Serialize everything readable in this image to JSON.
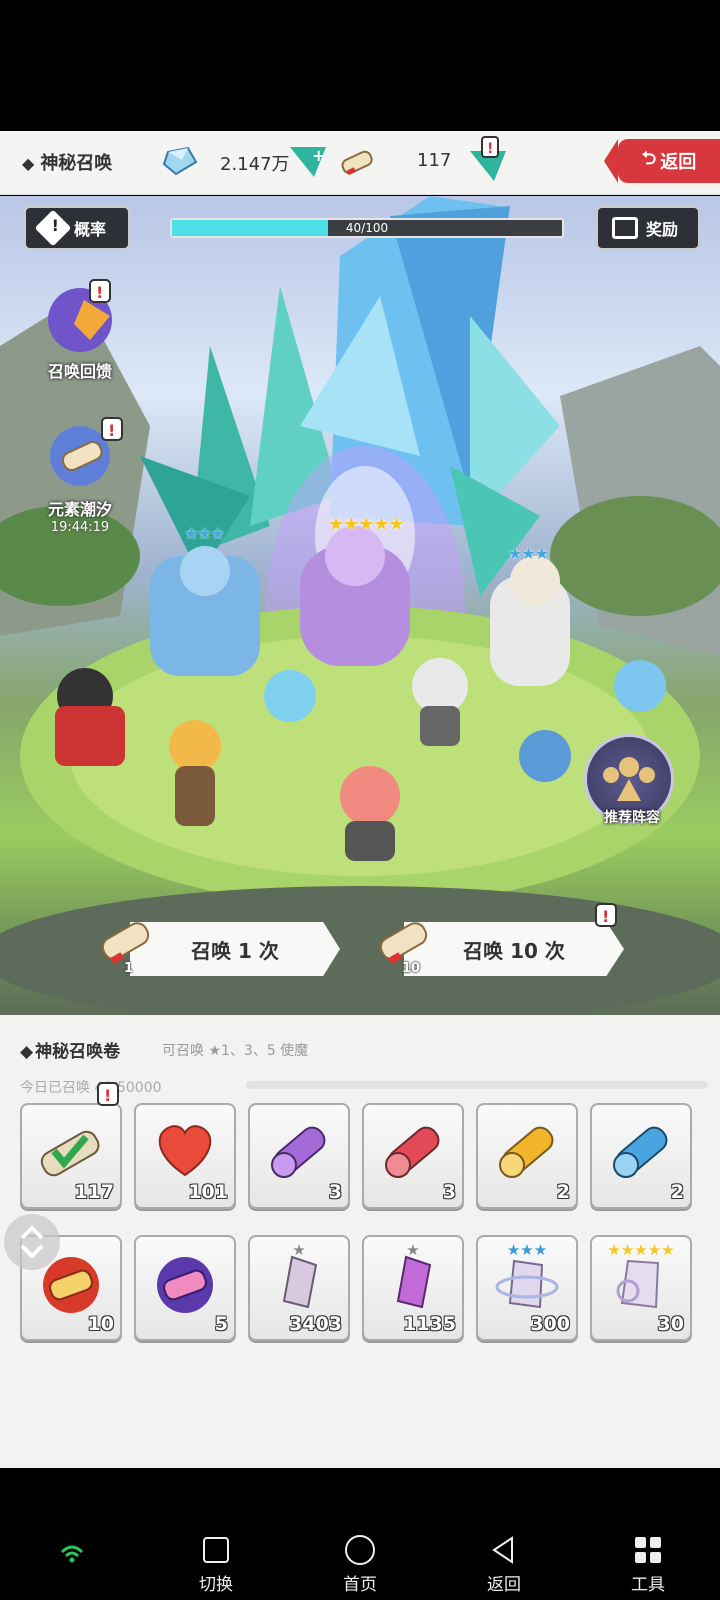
{
  "header": {
    "title": "神秘召唤",
    "gems": "2.147万",
    "scrolls": "117",
    "back_label": "返回"
  },
  "scene": {
    "rate_label": "概率",
    "reward_label": "奖励",
    "progress_text": "40/100",
    "progress_value": 0.4,
    "summon_feedback_label": "召唤回馈",
    "element_tide_label": "元素潮汐",
    "element_tide_timer": "19:44:19",
    "recommend_label": "推荐阵容",
    "summon_once_label": "召唤 1 次",
    "summon_once_cost": "1",
    "summon_ten_label": "召唤 10 次",
    "summon_ten_cost": "10"
  },
  "panel": {
    "title": "神秘召唤卷",
    "hint": "可召唤 ★1、3、5 使魔",
    "today": "今日已召唤 40/50000",
    "items": [
      {
        "name": "mystic-scroll",
        "count": "117"
      },
      {
        "name": "heart",
        "count": "101"
      },
      {
        "name": "purple-scroll",
        "count": "3"
      },
      {
        "name": "red-scroll",
        "count": "3"
      },
      {
        "name": "gold-scroll",
        "count": "2"
      },
      {
        "name": "blue-scroll",
        "count": "2"
      },
      {
        "name": "red-medal-scroll",
        "count": "10"
      },
      {
        "name": "purple-medal-scroll",
        "count": "5"
      },
      {
        "name": "one-star-shard",
        "count": "3403"
      },
      {
        "name": "one-star-purple-shard",
        "count": "1135"
      },
      {
        "name": "three-star-shard",
        "count": "300"
      },
      {
        "name": "five-star-shard",
        "count": "30"
      }
    ]
  },
  "navbar": {
    "switch": "切换",
    "home": "首页",
    "back": "返回",
    "tools": "工具"
  },
  "colors": {
    "accent_cyan": "#4ee0e8",
    "back_red": "#d8373d",
    "gold_star": "#f5c520"
  }
}
